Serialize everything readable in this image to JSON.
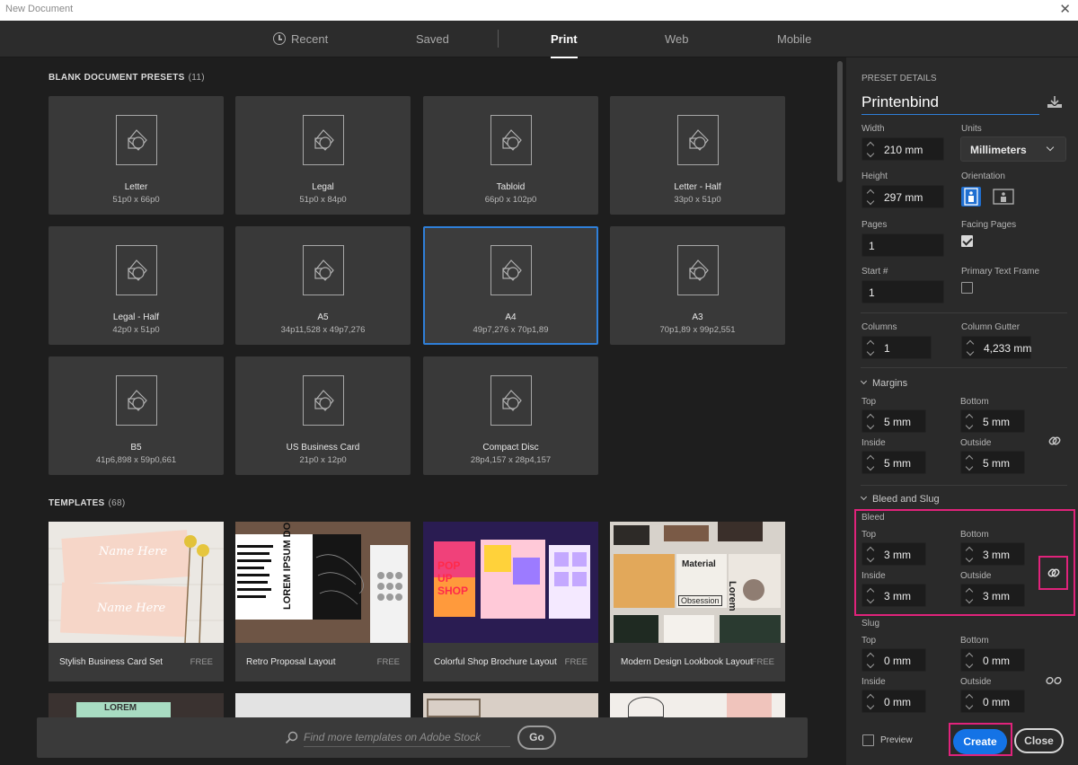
{
  "window": {
    "title": "New Document",
    "close_glyph": "✕"
  },
  "tabs": [
    {
      "label": "Recent",
      "icon": "clock-icon"
    },
    {
      "label": "Saved"
    },
    {
      "label": "Print",
      "active": true
    },
    {
      "label": "Web"
    },
    {
      "label": "Mobile"
    }
  ],
  "blank_presets": {
    "title": "BLANK DOCUMENT PRESETS",
    "count": "(11)",
    "items": [
      {
        "name": "Letter",
        "size": "51p0 x 66p0"
      },
      {
        "name": "Legal",
        "size": "51p0 x 84p0"
      },
      {
        "name": "Tabloid",
        "size": "66p0 x 102p0"
      },
      {
        "name": "Letter - Half",
        "size": "33p0 x 51p0"
      },
      {
        "name": "Legal - Half",
        "size": "42p0 x 51p0"
      },
      {
        "name": "A5",
        "size": "34p11,528 x 49p7,276"
      },
      {
        "name": "A4",
        "size": "49p7,276 x 70p1,89",
        "selected": true
      },
      {
        "name": "A3",
        "size": "70p1,89 x 99p2,551"
      },
      {
        "name": "B5",
        "size": "41p6,898 x 59p0,661"
      },
      {
        "name": "US Business Card",
        "size": "21p0 x 12p0"
      },
      {
        "name": "Compact Disc",
        "size": "28p4,157 x 28p4,157"
      }
    ]
  },
  "templates": {
    "title": "TEMPLATES",
    "count": "(68)",
    "items": [
      {
        "name": "Stylish Business Card Set",
        "badge": "FREE",
        "thumb_text_1": "Name Here",
        "thumb_text_2": "Name Here"
      },
      {
        "name": "Retro Proposal Layout",
        "badge": "FREE",
        "thumb_text_1": "LOREM IPSUM DO"
      },
      {
        "name": "Colorful Shop Brochure Layout",
        "badge": "FREE",
        "thumb_text_1": "POP UP SHOP"
      },
      {
        "name": "Modern Design Lookbook Layout",
        "badge": "FREE",
        "thumb_text_1": "Material",
        "thumb_text_2": "Obsession",
        "thumb_text_3": "Lorem"
      }
    ],
    "partial_row_text": "LOREM"
  },
  "stock_search": {
    "placeholder": "Find more templates on Adobe Stock",
    "go_label": "Go"
  },
  "preset_details": {
    "header": "PRESET DETAILS",
    "name": "Printenbind",
    "width_label": "Width",
    "width": "210 mm",
    "units_label": "Units",
    "units": "Millimeters",
    "height_label": "Height",
    "height": "297 mm",
    "orientation_label": "Orientation",
    "pages_label": "Pages",
    "pages": "1",
    "facing_pages_label": "Facing Pages",
    "facing_pages": true,
    "start_label": "Start #",
    "start": "1",
    "primary_text_frame_label": "Primary Text Frame",
    "primary_text_frame": false,
    "columns_label": "Columns",
    "columns": "1",
    "column_gutter_label": "Column Gutter",
    "column_gutter": "4,233 mm",
    "margins": {
      "label": "Margins",
      "top_label": "Top",
      "top": "5 mm",
      "bottom_label": "Bottom",
      "bottom": "5 mm",
      "inside_label": "Inside",
      "inside": "5 mm",
      "outside_label": "Outside",
      "outside": "5 mm"
    },
    "bleed_slug": {
      "label": "Bleed and Slug",
      "bleed_label": "Bleed",
      "bleed_top_label": "Top",
      "bleed_top": "3 mm",
      "bleed_bottom_label": "Bottom",
      "bleed_bottom": "3 mm",
      "bleed_inside_label": "Inside",
      "bleed_inside": "3 mm",
      "bleed_outside_label": "Outside",
      "bleed_outside": "3 mm",
      "slug_label": "Slug",
      "slug_top_label": "Top",
      "slug_top": "0 mm",
      "slug_bottom_label": "Bottom",
      "slug_bottom": "0 mm",
      "slug_inside_label": "Inside",
      "slug_inside": "0 mm",
      "slug_outside_label": "Outside",
      "slug_outside": "0 mm"
    },
    "preview_label": "Preview",
    "create_label": "Create",
    "close_label": "Close"
  },
  "colors": {
    "accent": "#1473e6",
    "highlight": "#e0237b",
    "selected_border": "#2f7fd8"
  }
}
